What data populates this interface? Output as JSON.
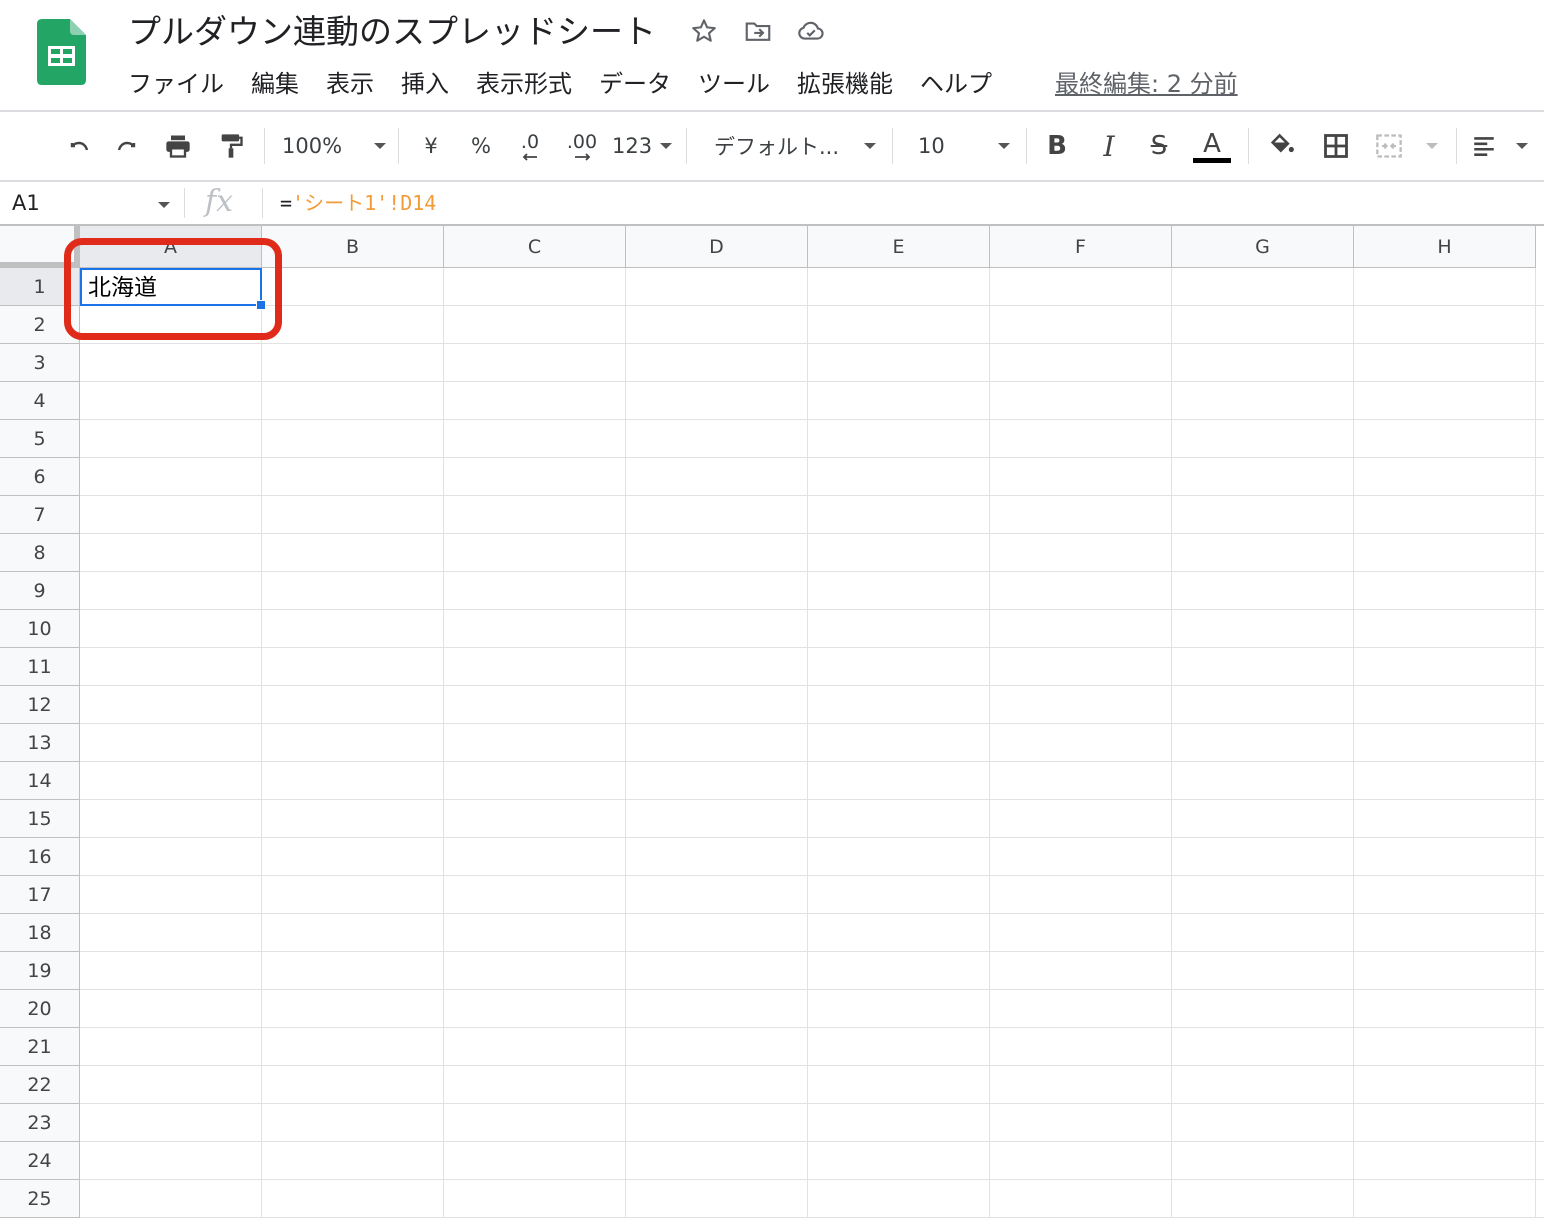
{
  "header": {
    "title": "プルダウン連動のスプレッドシート",
    "last_edit": "最終編集: 2 分前",
    "menu": [
      "ファイル",
      "編集",
      "表示",
      "挿入",
      "表示形式",
      "データ",
      "ツール",
      "拡張機能",
      "ヘルプ"
    ],
    "icons": [
      "sheets-logo-icon",
      "star-icon",
      "move-folder-icon",
      "cloud-status-icon"
    ]
  },
  "toolbar": {
    "zoom": "100%",
    "currency": "¥",
    "percent": "%",
    "decrease_decimal": ".0",
    "increase_decimal": ".00",
    "number_format": "123",
    "font": "デフォルト...",
    "font_size": "10",
    "bold": "B",
    "italic": "I",
    "strike": "S",
    "text_color": "A",
    "text_color_value": "#000000",
    "icons": [
      "undo-icon",
      "redo-icon",
      "print-icon",
      "paint-format-icon",
      "fill-color-icon",
      "borders-icon",
      "merge-cells-icon",
      "align-icon"
    ]
  },
  "formula_bar": {
    "name_box": "A1",
    "fx": "fx",
    "formula_prefix": "=",
    "formula_ref": "'シート1'!D14",
    "ref_color": "#f29b38"
  },
  "grid": {
    "columns": [
      "A",
      "B",
      "C",
      "D",
      "E",
      "F",
      "G",
      "H"
    ],
    "rows": [
      "1",
      "2",
      "3",
      "4",
      "5",
      "6",
      "7",
      "8",
      "9",
      "10",
      "11",
      "12",
      "13",
      "14",
      "15",
      "16",
      "17",
      "18",
      "19",
      "20",
      "21",
      "22",
      "23",
      "24",
      "25"
    ],
    "cells": {
      "A1": "北海道"
    },
    "selected_cell": "A1",
    "selection_color": "#1a73e8",
    "annotation_color": "#e02b1b"
  }
}
